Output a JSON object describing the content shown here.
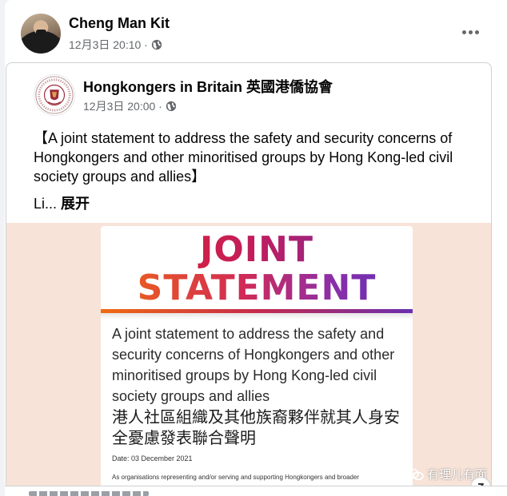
{
  "post": {
    "author": "Cheng Man Kit",
    "timestamp": "12月3日 20:10 ·",
    "audience_icon": "globe-icon",
    "more_icon": "more-options-icon"
  },
  "shared": {
    "page_name": "Hongkongers in Britain 英國港僑協會",
    "timestamp": "12月3日 20:00 ·",
    "text": "【A joint statement to address the safety and security concerns of Hongkongers and other minoritised groups by Hong Kong-led civil society groups and allies】",
    "truncated": "Li... ",
    "expand_label": "展开"
  },
  "image": {
    "title_line1": "JOINT",
    "title_line2": "STATEMENT",
    "body_en": "A joint statement to address the safety and security concerns of Hongkongers and other minoritised groups by Hong Kong-led civil society groups and allies",
    "body_zh": "港人社區組織及其他族裔夥伴就其人身安全憂慮發表聯合聲明",
    "date": "Date: 03 December 2021",
    "small_text": "As organisations representing and/or serving and supporting Hongkongers and broader"
  },
  "watermark": {
    "text": "有理儿有面",
    "icon": "wechat-icon"
  },
  "colors": {
    "text_primary": "#050505",
    "text_secondary": "#65676b",
    "media_bg": "#f7e3d8",
    "border": "#ced0d4"
  }
}
